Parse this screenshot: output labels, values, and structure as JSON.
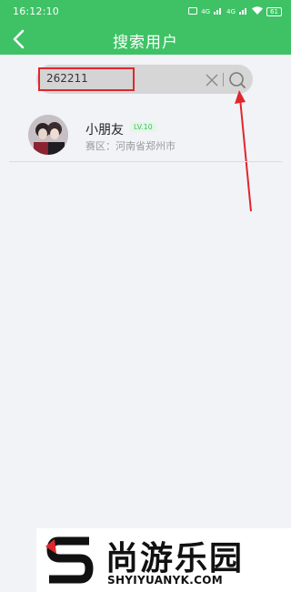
{
  "status_bar": {
    "time": "16:12:10",
    "network_1": "4G",
    "network_2": "4G",
    "battery": "61"
  },
  "header": {
    "title": "搜索用户",
    "back_icon": "chevron-left-icon"
  },
  "search": {
    "value": "262211",
    "clear_icon": "close-icon",
    "search_icon": "search-icon"
  },
  "results": [
    {
      "name": "小朋友",
      "level": "LV.10",
      "region_label": "赛区：",
      "region_value": "河南省郑州市"
    }
  ],
  "watermark": {
    "cn": "尚游乐园",
    "en": "SHYIYUANYK.COM"
  },
  "colors": {
    "brand_green": "#3ec265",
    "highlight_red": "#e1262d"
  }
}
